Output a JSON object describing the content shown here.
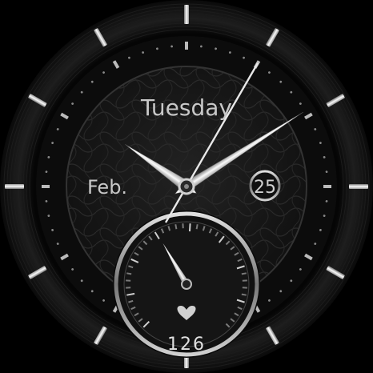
{
  "face": {
    "weekday": "Tuesday",
    "month": "Feb.",
    "day": "25",
    "heart_rate": "126",
    "heart_icon": "heart-icon"
  },
  "time": {
    "hour": 10,
    "minute": 9,
    "second": 35
  },
  "subdial": {
    "hand_angle_deg": -30
  },
  "colors": {
    "background": "#000000",
    "bezel": "#111111",
    "dial": "#1a1a1a",
    "text": "#c8c8c8",
    "hand": "#d9d9d9"
  }
}
